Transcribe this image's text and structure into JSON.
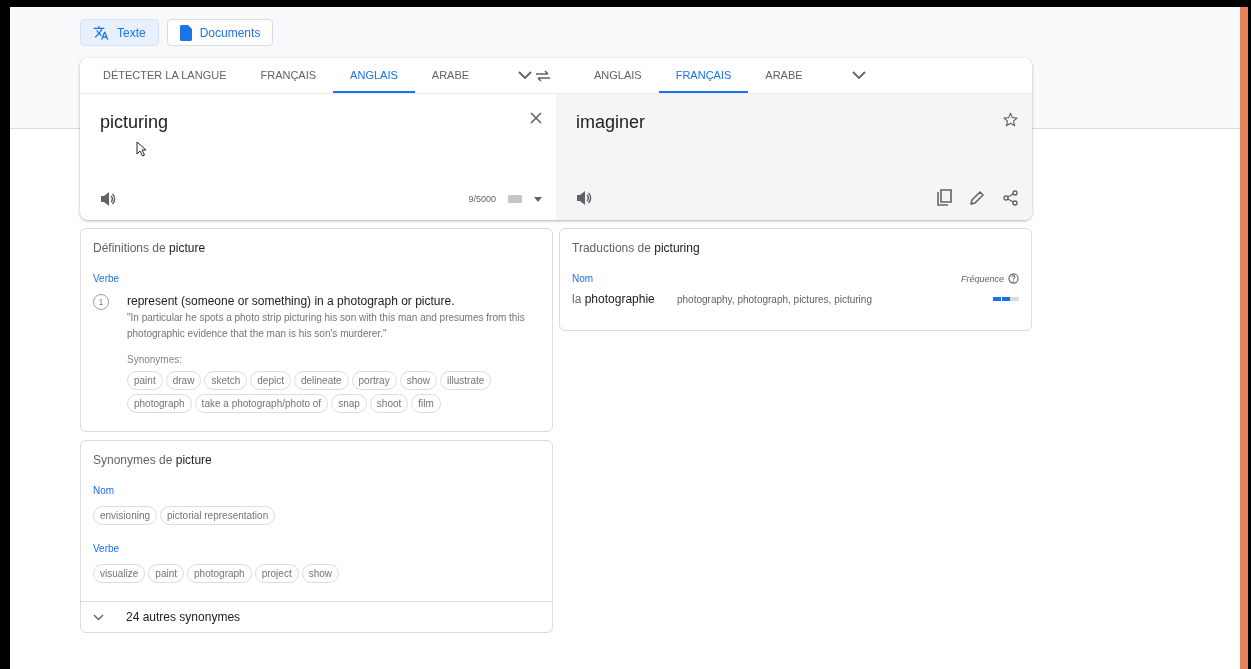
{
  "mode_tabs": [
    {
      "kind": "text",
      "label": "Texte",
      "selected": true
    },
    {
      "kind": "documents",
      "label": "Documents",
      "selected": false
    }
  ],
  "source_languages": [
    {
      "label": "DÉTECTER LA LANGUE",
      "selected": false
    },
    {
      "label": "FRANÇAIS",
      "selected": false
    },
    {
      "label": "ANGLAIS",
      "selected": true
    },
    {
      "label": "ARABE",
      "selected": false
    }
  ],
  "target_languages": [
    {
      "label": "ANGLAIS",
      "selected": false
    },
    {
      "label": "FRANÇAIS",
      "selected": true
    },
    {
      "label": "ARABE",
      "selected": false
    }
  ],
  "source": {
    "text": "picturing",
    "counter": "9/5000"
  },
  "target": {
    "text": "imaginer"
  },
  "definitions": {
    "title": "Définitions de **picture**",
    "groups": [
      {
        "pos": "Verbe",
        "entries": [
          {
            "number": "1",
            "definition": "represent (someone or something) in a photograph or picture.",
            "example": "\"In particular he spots a photo strip picturing his son with this man and presumes from this photographic evidence that the man is his son's murderer.\"",
            "synonyms_label": "Synonymes:",
            "synonyms": [
              "paint",
              "draw",
              "sketch",
              "depict",
              "delineate",
              "portray",
              "show",
              "illustrate",
              "photograph",
              "take a photograph/photo of",
              "snap",
              "shoot",
              "film"
            ]
          }
        ]
      }
    ]
  },
  "translations": {
    "title": "Traductions de **picturing**",
    "frequency_label": "Fréquence",
    "groups": [
      {
        "pos": "Nom",
        "rows": [
          {
            "word": "la **photographie**",
            "back": "photography, photograph, pictures, picturing",
            "level": 0.67
          }
        ]
      }
    ]
  },
  "synonyms": {
    "title": "Synonymes de **picture**",
    "groups": [
      {
        "pos": "Nom",
        "words": [
          "envisioning",
          "pictorial representation"
        ]
      },
      {
        "pos": "Verbe",
        "words": [
          "visualize",
          "paint",
          "photograph",
          "project",
          "show"
        ]
      }
    ],
    "more": "24 autres synonymes"
  }
}
